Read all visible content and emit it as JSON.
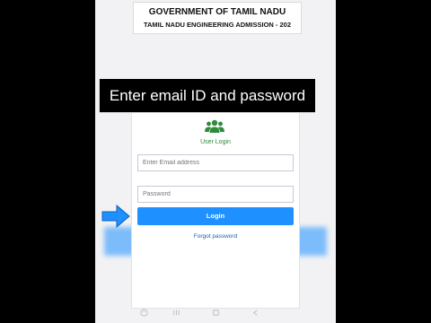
{
  "header": {
    "gov_title": "GOVERNMENT OF TAMIL NADU",
    "admission_title": "TAMIL NADU ENGINEERING ADMISSION - 202"
  },
  "banner": {
    "text": "Enter email ID and password"
  },
  "login": {
    "icon": "users-icon",
    "title": "User Login",
    "email_placeholder": "Enter Email address",
    "password_placeholder": "Password",
    "button_label": "Login",
    "forgot_label": "Forgot password"
  },
  "navbar": {
    "icons": [
      "accessibility-icon",
      "recent-apps-icon",
      "home-icon",
      "back-icon"
    ]
  },
  "colors": {
    "accent_blue": "#1e90ff",
    "login_green": "#2e8b3a",
    "link_blue": "#1e5fa8"
  }
}
